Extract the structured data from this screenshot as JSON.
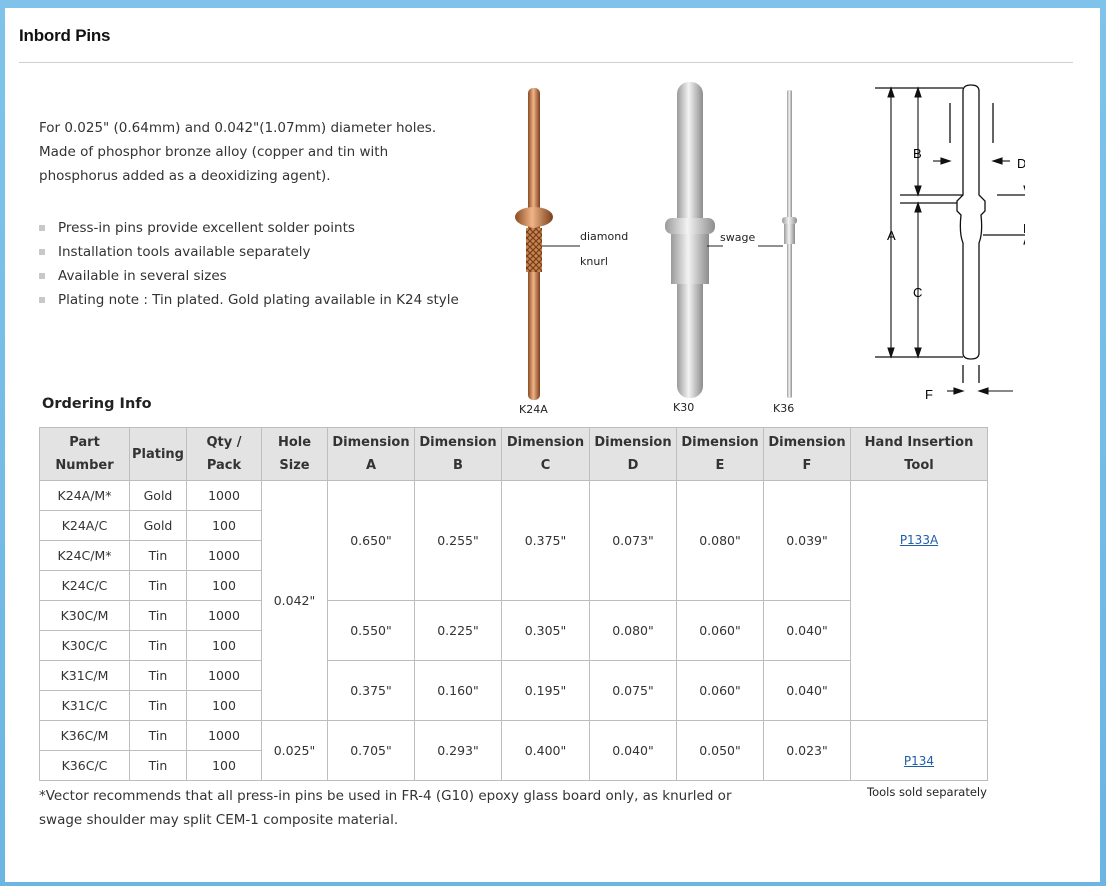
{
  "page": {
    "title": "Inbord Pins",
    "intro": [
      "For 0.025\" (0.64mm) and 0.042\"(1.07mm) diameter holes.",
      "Made of phosphor bronze alloy (copper and tin with",
      "phosphorus added as a deoxidizing agent)."
    ],
    "bullets": [
      "Press-in pins provide excellent solder points",
      "Installation tools available separately",
      "Available in several sizes",
      "Plating note : Tin plated. Gold plating available in K24 style"
    ]
  },
  "figures": {
    "pins": [
      {
        "label": "K24A",
        "color": "#c98a5a"
      },
      {
        "label": "K30",
        "color": "#c9c9c9"
      },
      {
        "label": "K36",
        "color": "#bdbdbd"
      }
    ],
    "callouts": {
      "diamond": "diamond",
      "knurl": "knurl",
      "swage": "swage"
    },
    "diagram_letters": [
      "A",
      "B",
      "C",
      "D",
      "E",
      "F"
    ]
  },
  "ordering": {
    "heading": "Ordering Info",
    "headers": [
      [
        "Part",
        "Number"
      ],
      [
        "Plating"
      ],
      [
        "Qty /",
        "Pack"
      ],
      [
        "Hole",
        "Size"
      ],
      [
        "Dimension",
        "A"
      ],
      [
        "Dimension",
        "B"
      ],
      [
        "Dimension",
        "C"
      ],
      [
        "Dimension",
        "D"
      ],
      [
        "Dimension",
        "E"
      ],
      [
        "Dimension",
        "F"
      ],
      [
        "Hand Insertion",
        "Tool"
      ]
    ],
    "parts": [
      {
        "part": "K24A/M*",
        "plating": "Gold",
        "qty": "1000"
      },
      {
        "part": "K24A/C",
        "plating": "Gold",
        "qty": "100"
      },
      {
        "part": "K24C/M*",
        "plating": "Tin",
        "qty": "1000"
      },
      {
        "part": "K24C/C",
        "plating": "Tin",
        "qty": "100"
      },
      {
        "part": "K30C/M",
        "plating": "Tin",
        "qty": "1000"
      },
      {
        "part": "K30C/C",
        "plating": "Tin",
        "qty": "100"
      },
      {
        "part": "K31C/M",
        "plating": "Tin",
        "qty": "1000"
      },
      {
        "part": "K31C/C",
        "plating": "Tin",
        "qty": "100"
      },
      {
        "part": "K36C/M",
        "plating": "Tin",
        "qty": "1000"
      },
      {
        "part": "K36C/C",
        "plating": "Tin",
        "qty": "100"
      }
    ],
    "hole_sizes": [
      "0.042\"",
      "0.025\""
    ],
    "dims": [
      {
        "a": "0.650\"",
        "b": "0.255\"",
        "c": "0.375\"",
        "d": "0.073\"",
        "e": "0.080\"",
        "f": "0.039\""
      },
      {
        "a": "0.550\"",
        "b": "0.225\"",
        "c": "0.305\"",
        "d": "0.080\"",
        "e": "0.060\"",
        "f": "0.040\""
      },
      {
        "a": "0.375\"",
        "b": "0.160\"",
        "c": "0.195\"",
        "d": "0.075\"",
        "e": "0.060\"",
        "f": "0.040\""
      },
      {
        "a": "0.705\"",
        "b": "0.293\"",
        "c": "0.400\"",
        "d": "0.040\"",
        "e": "0.050\"",
        "f": "0.023\""
      }
    ],
    "tools": [
      "P133A",
      "P134"
    ],
    "footnote": [
      "*Vector recommends that all press-in pins be used in FR-4 (G10) epoxy glass board only, as knurled or",
      "swage shoulder may split CEM-1 composite material."
    ],
    "tools_note": "Tools sold separately"
  }
}
